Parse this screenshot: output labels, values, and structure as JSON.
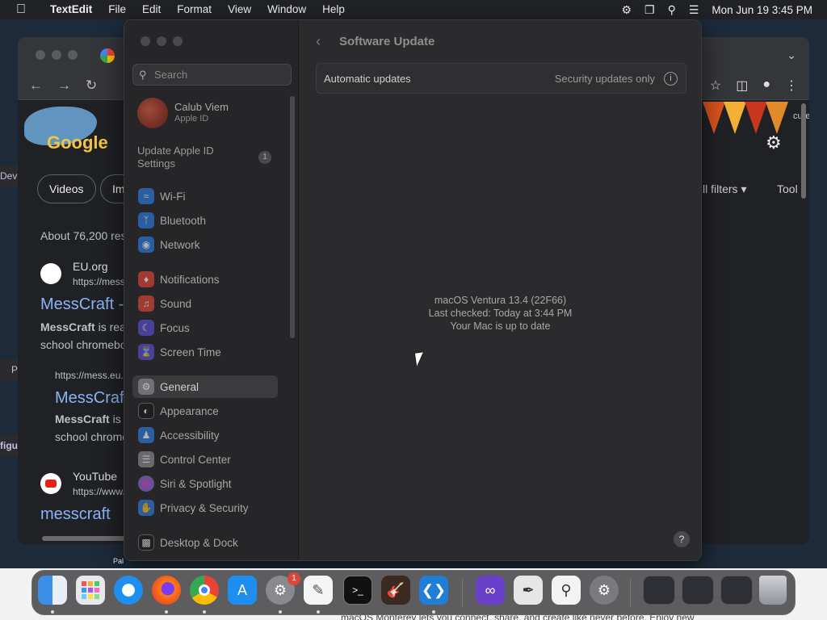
{
  "menubar": {
    "app_name": "TextEdit",
    "menus": [
      "File",
      "Edit",
      "Format",
      "View",
      "Window",
      "Help"
    ],
    "status_icons": [
      "screen-time-icon",
      "screen-mirror-icon",
      "spotlight-search-icon",
      "control-center-icon"
    ],
    "datetime": "Mon Jun 19  3:45 PM"
  },
  "chrome": {
    "chips": [
      "Videos",
      "Im"
    ],
    "filter_all": "ll filters ▾",
    "filter_tools": "Tool",
    "results_count": "About 76,200 res",
    "result1": {
      "site": "EU.org",
      "url": "https://mess",
      "title": "MessCraft -",
      "snippet_line1_bold": "MessCraft",
      "snippet_line1_rest": " is rea",
      "snippet_line2": "school chromebo",
      "sub_url": "https://mess.eu.",
      "sub_title": "MessCraf",
      "sub_snippet_bold": "MessCraft",
      "sub_snippet_rest": " is",
      "sub_snippet_line2": "school chrome"
    },
    "result2": {
      "site": "YouTube",
      "url": "https://www.",
      "title": "messcraft"
    },
    "right_edge_text": "cure",
    "doodle_text": "Google"
  },
  "slivers": [
    "Dev",
    "P",
    "figu"
  ],
  "settings": {
    "search_placeholder": "Search",
    "account_name": "Calub Viem",
    "account_sub": "Apple ID",
    "update_label": "Update Apple ID Settings",
    "update_badge": "1",
    "sidebar": [
      {
        "label": "Wi-Fi",
        "icon": "wifi-icon",
        "color": "#2f7de1"
      },
      {
        "label": "Bluetooth",
        "icon": "bluetooth-icon",
        "color": "#2f7de1"
      },
      {
        "label": "Network",
        "icon": "globe-icon",
        "color": "#2f7de1"
      },
      {
        "label": "Notifications",
        "icon": "bell-icon",
        "color": "#e5453b"
      },
      {
        "label": "Sound",
        "icon": "speaker-icon",
        "color": "#e5453b"
      },
      {
        "label": "Focus",
        "icon": "moon-icon",
        "color": "#5b4fd6"
      },
      {
        "label": "Screen Time",
        "icon": "hourglass-icon",
        "color": "#5b4fd6"
      },
      {
        "label": "General",
        "icon": "gear-icon",
        "color": "#8e8e93"
      },
      {
        "label": "Appearance",
        "icon": "appearance-icon",
        "color": "#1c1c1e"
      },
      {
        "label": "Accessibility",
        "icon": "accessibility-icon",
        "color": "#2f7de1"
      },
      {
        "label": "Control Center",
        "icon": "control-center-icon",
        "color": "#8e8e93"
      },
      {
        "label": "Siri & Spotlight",
        "icon": "siri-icon",
        "color": "#b04ad6"
      },
      {
        "label": "Privacy & Security",
        "icon": "hand-icon",
        "color": "#2f7de1"
      },
      {
        "label": "Desktop & Dock",
        "icon": "dock-icon",
        "color": "#1c1c1e"
      }
    ],
    "active_item": "General",
    "page_title": "Software Update",
    "auto_updates_label": "Automatic updates",
    "auto_updates_value": "Security updates only",
    "status_line1": "macOS Ventura 13.4 (22F66)",
    "status_line2": "Last checked: Today at 3:44 PM",
    "status_line3": "Your Mac is up to date",
    "help": "?"
  },
  "dock": {
    "apps": [
      "finder-icon",
      "launchpad-icon",
      "safari-icon",
      "firefox-icon",
      "chrome-icon",
      "app-store-icon",
      "system-settings-icon",
      "textedit-icon",
      "terminal-icon",
      "garageband-icon",
      "vscode-icon",
      "visual-studio-icon",
      "script-editor-icon",
      "preview-icon",
      "settings-gear-icon",
      "window-thumbnail-1",
      "window-thumbnail-2",
      "window-thumbnail-3",
      "trash-icon"
    ],
    "settings_badge": "1"
  },
  "bottom_text": "macOS Monterey lets you connect, share, and create like never before. Enjoy new",
  "pal_label": "Pal"
}
